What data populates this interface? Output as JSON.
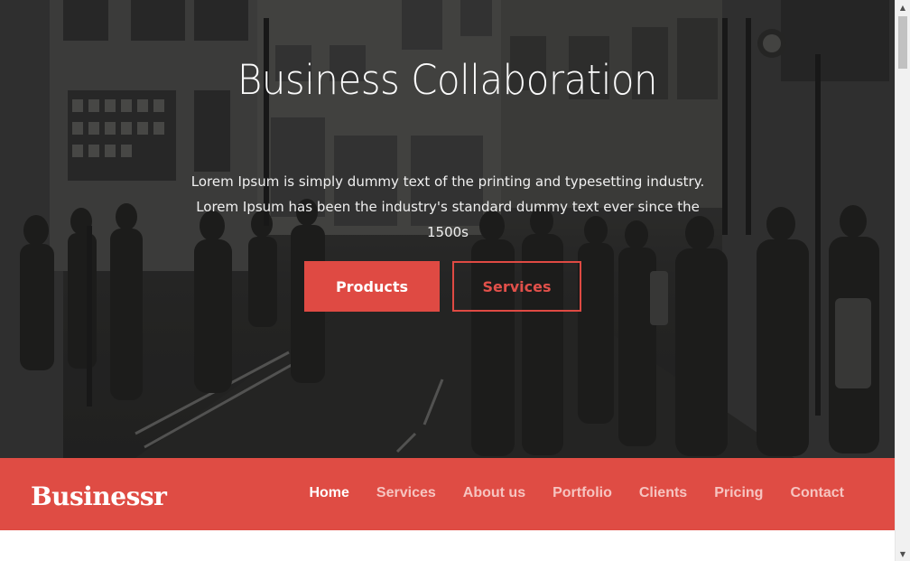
{
  "hero": {
    "title": "Business Collaboration",
    "text": "Lorem Ipsum is simply dummy text of the printing and typesetting industry. Lorem Ipsum has been the industry's standard dummy text ever since the 1500s",
    "primary_button": "Products",
    "secondary_button": "Services"
  },
  "navbar": {
    "logo": "Businessr",
    "items": [
      {
        "label": "Home",
        "active": true
      },
      {
        "label": "Services",
        "active": false
      },
      {
        "label": "About us",
        "active": false
      },
      {
        "label": "Portfolio",
        "active": false
      },
      {
        "label": "Clients",
        "active": false
      },
      {
        "label": "Pricing",
        "active": false
      },
      {
        "label": "Contact",
        "active": false
      }
    ]
  },
  "colors": {
    "accent": "#df4c44",
    "active_nav": "#ffffff",
    "inactive_nav": "#f6c4c0"
  },
  "icons": {
    "scroll_up": "scroll-up-icon",
    "scroll_down": "scroll-down-icon"
  }
}
